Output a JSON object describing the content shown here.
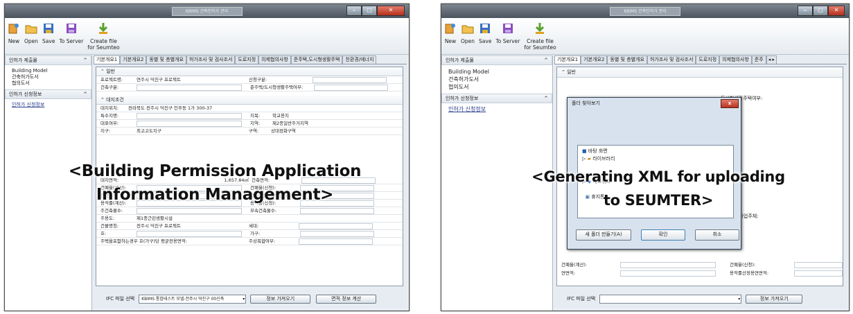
{
  "left": {
    "window_title": "KBIMS 건축인허가 관리",
    "toolbar": [
      {
        "label": "New",
        "icon": "new-icon"
      },
      {
        "label": "Open",
        "icon": "open-folder-icon"
      },
      {
        "label": "Save",
        "icon": "save-icon"
      },
      {
        "label": "To Server",
        "icon": "server-icon"
      },
      {
        "label": "Create file\nfor Seumteo",
        "icon": "create-file-icon"
      }
    ],
    "sidebar": {
      "section1_title": "인허가 제출물",
      "items": [
        "Building Model",
        "건축허가도서",
        "협의도서"
      ],
      "section2_title": "인허가 신청정보",
      "link": "인허가 신청정보"
    },
    "tabs": [
      "기본개요1",
      "기본개요2",
      "동별 및 층별개요",
      "허가조사 및 검사조서",
      "도로지정",
      "의제협의사항",
      "준주택,도시형생활주택",
      "친환경/에너지"
    ],
    "section1": {
      "title": "일반",
      "rows": [
        {
          "l1": "프로젝트명:",
          "v1": "연주시 덕진구 프로젝트",
          "l2": "신청구분:",
          "v2": ""
        },
        {
          "l1": "건축구분:",
          "v1": "",
          "l2": "준주택/도시형생활주택여부:",
          "v2": ""
        }
      ]
    },
    "section2": {
      "title": "대지조건",
      "rows": [
        {
          "l1": "대지위치:",
          "v1": "전라북도 전주시 덕진구 인후동 1가 300-37",
          "l2": "",
          "v2": ""
        },
        {
          "l1": "특수지명:",
          "v1": "",
          "l2": "지목:",
          "v2": "학교용지"
        },
        {
          "l1": "대표여부:",
          "v1": "",
          "l2": "지역:",
          "v2": "제2종일반주거지역"
        },
        {
          "l1": "지구:",
          "v1": "최고고도지구",
          "l2": "구역:",
          "v2": "상대정화구역"
        }
      ]
    },
    "section3": {
      "title": "",
      "rows": [
        {
          "l1": "대지면적:",
          "v1": "1,657.84㎡",
          "l2": "건축면적:",
          "v2": ""
        },
        {
          "l1": "건폐율(계산):",
          "v1": "",
          "l2": "건폐율(신청):",
          "v2": ""
        },
        {
          "l1": "연면적:",
          "v1": "",
          "l2": "용적률산정용연면적:",
          "v2": ""
        },
        {
          "l1": "용적률(계산):",
          "v1": "",
          "l2": "용적률(신청):",
          "v2": ""
        },
        {
          "l1": "주건축물수:",
          "v1": "",
          "l2": "부속건축물수:",
          "v2": ""
        },
        {
          "l1": "주용도:",
          "v1": "제1종근린생활시설",
          "l2": "",
          "v2": ""
        },
        {
          "l1": "건물명칭:",
          "v1": "전주시 덕진구 프로젝트",
          "l2": "세대:",
          "v2": ""
        },
        {
          "l1": "호:",
          "v1": "",
          "l2": "가구:",
          "v2": ""
        },
        {
          "l1": "주택을포함하는경우 호(가구)당 평균전용면적:",
          "v1": "",
          "l2": "주상복합여부:",
          "v2": ""
        }
      ]
    },
    "bottom": {
      "label": "IFC 파일 선택",
      "combo_value": "KBIMS 통합테스트 모델-전주시 덕진구 00신축",
      "btn1": "정보 가져오기",
      "btn2": "면적 정보 계산"
    },
    "overlay_line1": "<Building Permission Application",
    "overlay_line2": "Information Management>"
  },
  "right": {
    "window_title": "KBIMS 건축인허가 관리",
    "toolbar": [
      {
        "label": "New",
        "icon": "new-icon"
      },
      {
        "label": "Open",
        "icon": "open-folder-icon"
      },
      {
        "label": "Save",
        "icon": "save-icon"
      },
      {
        "label": "To Server",
        "icon": "server-icon"
      },
      {
        "label": "Create file\nfor Seumteo",
        "icon": "create-file-icon"
      }
    ],
    "sidebar": {
      "section1_title": "인허가 제출물",
      "items": [
        "Building Model",
        "건축허가도서",
        "협의도서"
      ],
      "section2_title": "인허가 신청정보",
      "link": "인허가 신청정보"
    },
    "tabs": [
      "기본개요1",
      "기본개요2",
      "동별 및 층별개요",
      "허가조사 및 검사조서",
      "도로지정",
      "의제협의사항",
      "준주"
    ],
    "section1_title": "일반",
    "visible_labels": {
      "a": "도시형생활주택여부:",
      "b": "업사업주체:",
      "c1": "건폐율(계산):",
      "c2": "건폐율(신청):",
      "d1": "연면적:",
      "d2": "용적률산정용연면적:"
    },
    "dialog": {
      "title": "폴더 찾아보기",
      "tree": [
        "바탕 화면",
        "라이브러리",
        "",
        "",
        "네트워크",
        "",
        "휴지통"
      ],
      "btn_new": "새 폴더 만들기(A)",
      "btn_ok": "확인",
      "btn_cancel": "취소"
    },
    "bottom": {
      "label": "IFC 파일 선택",
      "combo_value": "",
      "btn1": "정보 가져오기"
    },
    "overlay_line1": "<Generating XML for uploading",
    "overlay_line2": "to SEUMTER>"
  },
  "colors": {
    "titlebar": "#5a636d",
    "close": "#c0392b",
    "link": "#2a3c8c"
  }
}
